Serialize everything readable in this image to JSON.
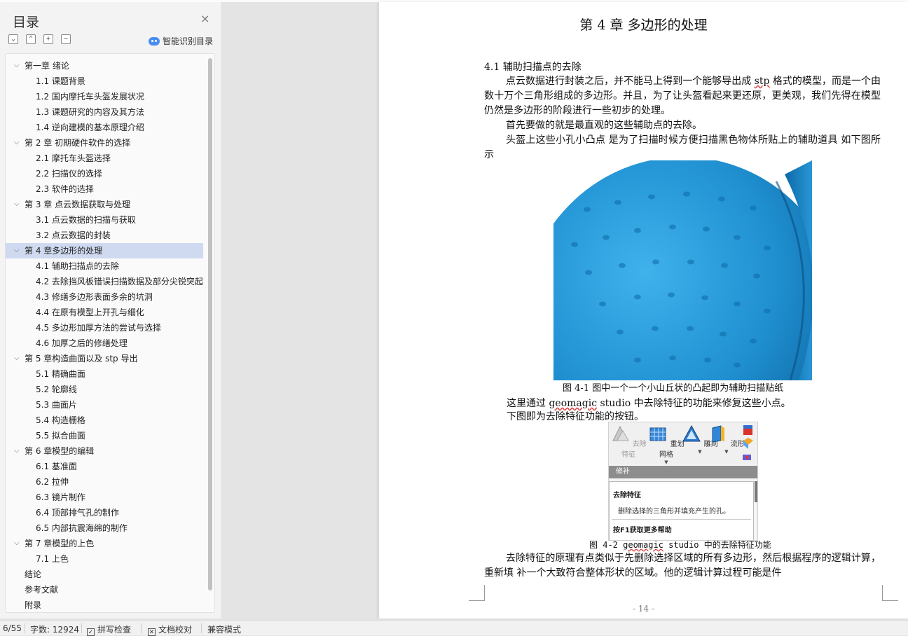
{
  "sidebar": {
    "title": "目录",
    "close_glyph": "×",
    "smart_label": "智能识别目录",
    "toc": [
      {
        "label": "第一章  绪论",
        "level": 1,
        "expanded": true
      },
      {
        "label": "1.1 课题背景",
        "level": 2
      },
      {
        "label": "1.2 国内摩托车头盔发展状况",
        "level": 2
      },
      {
        "label": "1.3 课题研究的内容及其方法",
        "level": 2
      },
      {
        "label": "1.4 逆向建模的基本原理介绍",
        "level": 2
      },
      {
        "label": "第 2 章  初期硬件软件的选择",
        "level": 1,
        "expanded": true
      },
      {
        "label": "2.1 摩托车头盔选择",
        "level": 2
      },
      {
        "label": "2.2 扫描仪的选择",
        "level": 2
      },
      {
        "label": "2.3  软件的选择",
        "level": 2
      },
      {
        "label": "第 3 章    点云数据获取与处理",
        "level": 1,
        "expanded": true
      },
      {
        "label": "3.1  点云数据的扫描与获取",
        "level": 2
      },
      {
        "label": "3.2  点云数据的封装",
        "level": 2
      },
      {
        "label": "第 4 章多边形的处理",
        "level": 1,
        "expanded": true,
        "selected": true
      },
      {
        "label": "4.1  辅助扫描点的去除",
        "level": 2
      },
      {
        "label": "4.2  去除挡风板错误扫描数据及部分尖锐突起",
        "level": 2
      },
      {
        "label": "4.3  修缮多边形表面多余的坑洞",
        "level": 2
      },
      {
        "label": "4.4  在原有模型上开孔与细化",
        "level": 2
      },
      {
        "label": "4.5  多边形加厚方法的尝试与选择",
        "level": 2
      },
      {
        "label": "4.6  加厚之后的修缮处理",
        "level": 2
      },
      {
        "label": "第 5 章构造曲面以及 stp 导出",
        "level": 1,
        "expanded": true
      },
      {
        "label": "5.1  精确曲面",
        "level": 2
      },
      {
        "label": "5.2  轮廓线",
        "level": 2
      },
      {
        "label": "5.3  曲面片",
        "level": 2
      },
      {
        "label": "5.4  构造栅格",
        "level": 2
      },
      {
        "label": "5.5  拟合曲面",
        "level": 2
      },
      {
        "label": "第 6 章模型的编辑",
        "level": 1,
        "expanded": true
      },
      {
        "label": "6.1  基准面",
        "level": 2
      },
      {
        "label": "6.2  拉伸",
        "level": 2
      },
      {
        "label": "6.3  镜片制作",
        "level": 2
      },
      {
        "label": "6.4  顶部排气孔的制作",
        "level": 2
      },
      {
        "label": "6.5  内部抗震海绵的制作",
        "level": 2
      },
      {
        "label": "第 7 章模型的上色",
        "level": 1,
        "expanded": true
      },
      {
        "label": "7.1  上色",
        "level": 2
      },
      {
        "label": "结论",
        "level": 1
      },
      {
        "label": "参考文献",
        "level": 1
      },
      {
        "label": "附录",
        "level": 1
      }
    ]
  },
  "document": {
    "chapter_title": "第 4 章  多边形的处理",
    "section_heading": "4.1  辅助扫描点的去除",
    "p1_a": "点云数据进行封装之后，并不能马上得到一个能够导出成 ",
    "p1_stp": "stp",
    "p1_b": " 格式的模型，而是一个由数十万个三角形组成的多边形。并且，为了让头盔看起来更还原，更美观，我们先得在模型仍然是多边形的阶段进行一些初步的处理。",
    "p2": "首先要做的就是最直观的这些辅助点的去除。",
    "p3": "头盔上这些小孔小凸点  是为了扫描时候方便扫描黑色物体所贴上的辅助道具  如下图所示",
    "fig1_caption": "图 4-1 图中一个一个小山丘状的凸起即为辅助扫描贴纸",
    "line4_a": "这里通过 ",
    "line4_geo": "geomagic",
    "line4_b": " studio 中去除特征的功能来修复这些小点。",
    "line5": "下图即为去除特征功能的按钮。",
    "fig2_caption_a": "图 4-2 ",
    "fig2_caption_geo": "geomagic",
    "fig2_caption_b": " studio 中的去除特征功能",
    "p6": "去除特征的原理有点类似于先删除选择区域的所有多边形，然后根据程序的逻辑计算，重新填 补一个大致符合整体形状的区域。他的逻辑计算过程可能是件",
    "page_number": "- 14 -"
  },
  "ribbon": {
    "buttons": [
      {
        "label": "去除特征",
        "icon": "remove-feature-icon",
        "dim": true
      },
      {
        "label": "重划网格",
        "icon": "remesh-icon"
      },
      {
        "label": "雕刻",
        "icon": "sculpt-icon"
      },
      {
        "label": "流形",
        "icon": "manifold-icon"
      }
    ],
    "group_label": "修补",
    "tooltip_title": "去除特征",
    "tooltip_desc": "删除选择的三角形并填充产生的孔。",
    "tooltip_help": "按F1获取更多帮助"
  },
  "statusbar": {
    "page_info": "6/55",
    "word_count": "字数: 12924",
    "spell_check": "拼写检查",
    "doc_proof": "文档校对",
    "compat_mode": "兼容模式"
  },
  "colors": {
    "accent_blue": "#4a8df0",
    "selected_row": "#cfdaf1",
    "helmet_blue": "#1f8fd0"
  }
}
